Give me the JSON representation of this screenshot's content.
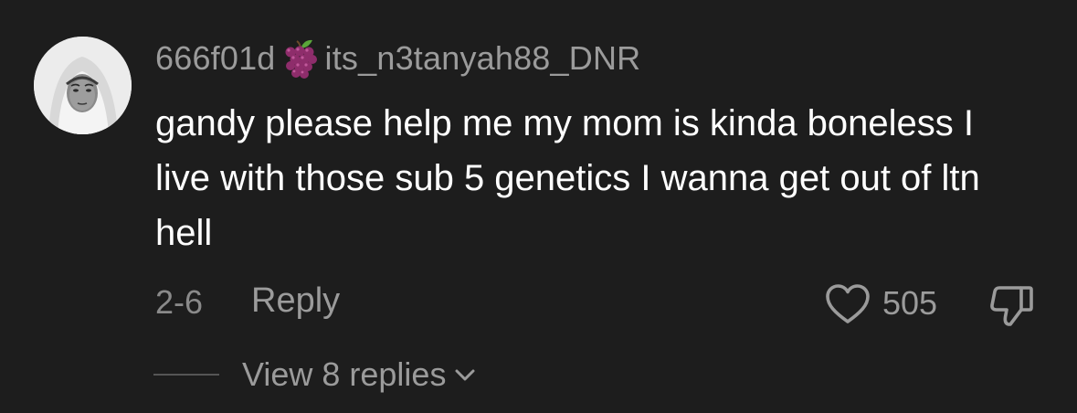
{
  "comment": {
    "username_prefix": "666f01d",
    "username_emoji": "grapes-icon",
    "username_suffix": "its_n3tanyah88_DNR",
    "text": "gandy please help me my mom is kinda boneless I live with those sub 5 genetics I wanna get out of ltn hell",
    "timestamp": "2-6",
    "reply_label": "Reply",
    "like_count": "505",
    "view_replies_label": "View 8 replies"
  },
  "icons": {
    "like": "heart-outline-icon",
    "dislike": "thumbs-down-icon",
    "expand": "chevron-down-icon"
  },
  "colors": {
    "background": "#1d1d1d",
    "text_primary": "#ffffff",
    "text_secondary": "#9b9b9b"
  }
}
